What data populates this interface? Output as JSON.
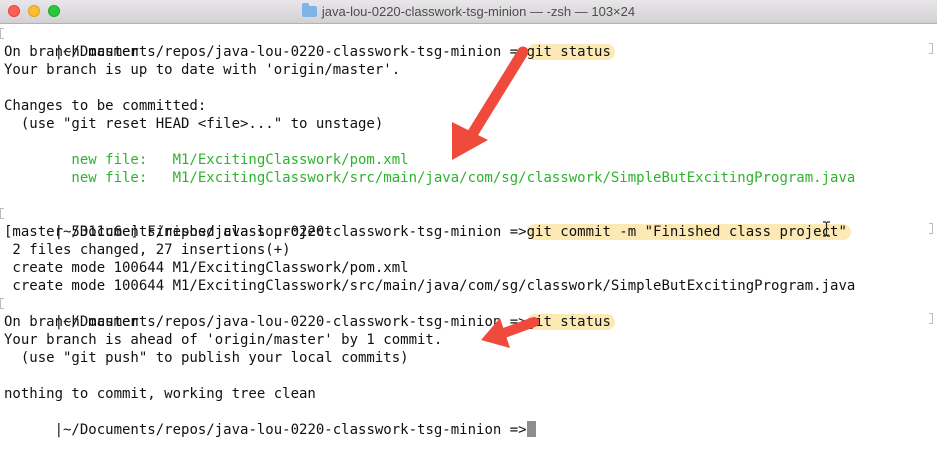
{
  "window": {
    "title": "java-lou-0220-classwork-tsg-minion — -zsh — 103×24"
  },
  "terminal": {
    "lines": [
      {
        "text": "|~/Documents/repos/java-lou-0220-classwork-tsg-minion =>",
        "cmd": "git status"
      },
      {
        "text": "On branch master"
      },
      {
        "text": "Your branch is up to date with 'origin/master'."
      },
      {
        "text": ""
      },
      {
        "text": "Changes to be committed:"
      },
      {
        "text": "  (use \"git reset HEAD <file>...\" to unstage)"
      },
      {
        "text": ""
      },
      {
        "text": "        new file:   M1/ExcitingClasswork/pom.xml"
      },
      {
        "text": "        new file:   M1/ExcitingClasswork/src/main/java/com/sg/classwork/SimpleButExcitingProgram.java"
      },
      {
        "text": ""
      },
      {
        "text": "|~/Documents/repos/java-lou-0220-classwork-tsg-minion =>",
        "cmd": "git commit -m \"Finished class project\""
      },
      {
        "text": "[master 5311c6e] Finished class project"
      },
      {
        "text": " 2 files changed, 27 insertions(+)"
      },
      {
        "text": " create mode 100644 M1/ExcitingClasswork/pom.xml"
      },
      {
        "text": " create mode 100644 M1/ExcitingClasswork/src/main/java/com/sg/classwork/SimpleButExcitingProgram.java"
      },
      {
        "text": "|~/Documents/repos/java-lou-0220-classwork-tsg-minion =>",
        "cmd": "git status"
      },
      {
        "text": "On branch master"
      },
      {
        "text": "Your branch is ahead of 'origin/master' by 1 commit."
      },
      {
        "text": "  (use \"git push\" to publish your local commits)"
      },
      {
        "text": ""
      },
      {
        "text": "nothing to commit, working tree clean"
      },
      {
        "text": "|~/Documents/repos/java-lou-0220-classwork-tsg-minion =>"
      }
    ]
  },
  "colors": {
    "highlight": "#fde9b4",
    "green_text": "#2eb32e",
    "arrow": "#ef4a3c"
  }
}
